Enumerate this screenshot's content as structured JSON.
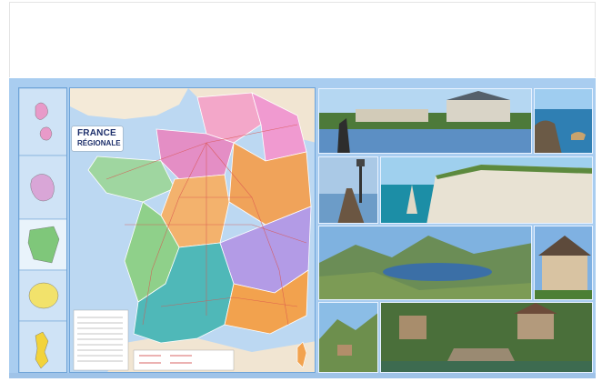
{
  "map": {
    "title_line1": "FRANCE",
    "title_line2": "RÉGIONALE"
  },
  "colors": {
    "frame": "#a9cdf0",
    "sea": "#bcd8f2",
    "region_pink": "#e89ac9",
    "region_orange": "#f0a35a",
    "region_green": "#8fd08a",
    "region_purple": "#b39be6",
    "region_teal": "#4fb8b8"
  },
  "photos": [
    {
      "name": "chateau-photo"
    },
    {
      "name": "coast-island-photo"
    },
    {
      "name": "pier-lantern-photo"
    },
    {
      "name": "cliffs-photo"
    },
    {
      "name": "mountain-lake-photo"
    },
    {
      "name": "half-timbered-house-photo"
    },
    {
      "name": "alpine-village-photo"
    },
    {
      "name": "stone-bridge-village-photo"
    }
  ]
}
